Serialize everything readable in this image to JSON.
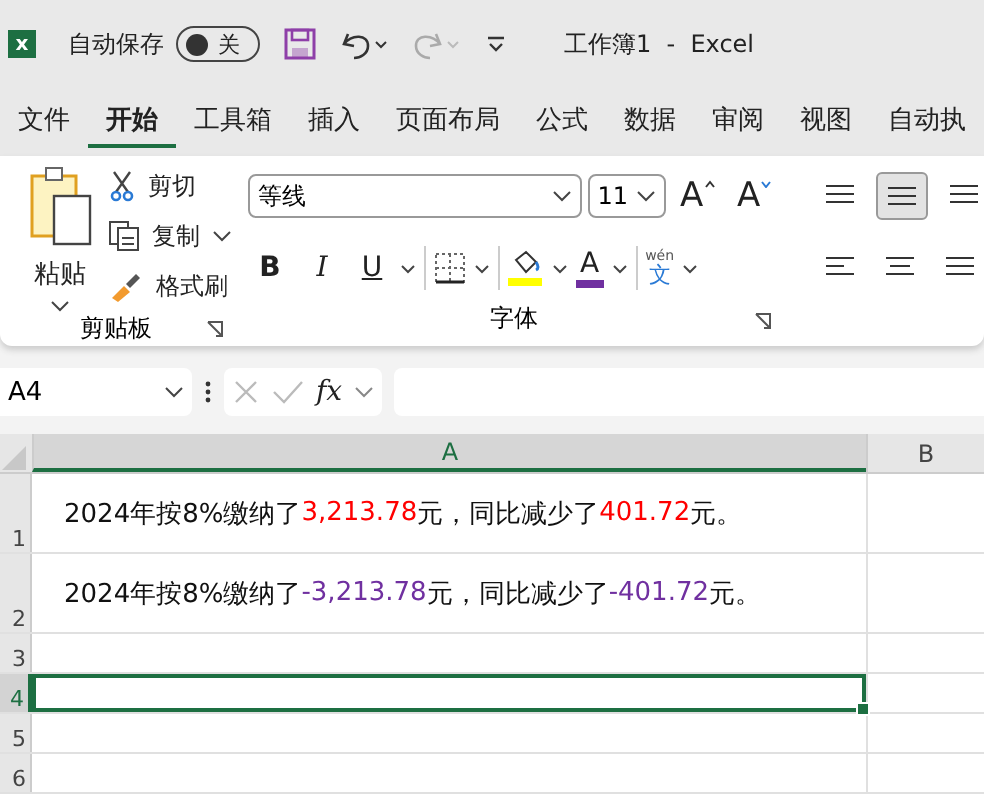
{
  "title_bar": {
    "app_letter": "x",
    "autosave_label": "自动保存",
    "autosave": {
      "on": false,
      "label": "关"
    },
    "title": "工作簿1  -  Excel"
  },
  "tabs": [
    {
      "label": "文件",
      "selected": false
    },
    {
      "label": "开始",
      "selected": true
    },
    {
      "label": "工具箱",
      "selected": false
    },
    {
      "label": "插入",
      "selected": false
    },
    {
      "label": "页面布局",
      "selected": false
    },
    {
      "label": "公式",
      "selected": false
    },
    {
      "label": "数据",
      "selected": false
    },
    {
      "label": "审阅",
      "selected": false
    },
    {
      "label": "视图",
      "selected": false
    },
    {
      "label": "自动执",
      "selected": false
    }
  ],
  "ribbon": {
    "clipboard": {
      "title": "剪贴板",
      "paste": "粘贴",
      "cut": "剪切",
      "copy": "复制",
      "format_painter": "格式刷"
    },
    "font": {
      "title": "字体",
      "font_name": "等线",
      "font_size": "11",
      "grow": "A",
      "shrink": "A",
      "bold": "B",
      "italic": "I",
      "underline": "U",
      "font_color_letter": "A",
      "phonetic_top": "wén",
      "phonetic_char": "文"
    }
  },
  "formula_bar": {
    "name_box": "A4",
    "function_label": "fx"
  },
  "sheet": {
    "columns": [
      {
        "label": "A",
        "selected": true
      },
      {
        "label": "B",
        "selected": false
      }
    ],
    "rows": [
      {
        "label": "1",
        "selected": false,
        "segments": [
          {
            "text": "2024年按8%缴纳了"
          },
          {
            "text": "3,213.78",
            "color": "#ff0000"
          },
          {
            "text": "元，同比减少了"
          },
          {
            "text": "401.72",
            "color": "#ff0000"
          },
          {
            "text": "元。"
          }
        ]
      },
      {
        "label": "2",
        "selected": false,
        "segments": [
          {
            "text": "2024年按8%缴纳了"
          },
          {
            "text": "-3,213.78",
            "color": "#7030a0"
          },
          {
            "text": "元，同比减少了"
          },
          {
            "text": "-401.72",
            "color": "#7030a0"
          },
          {
            "text": "元。"
          }
        ]
      },
      {
        "label": "3",
        "selected": false
      },
      {
        "label": "4",
        "selected": true
      },
      {
        "label": "5",
        "selected": false
      },
      {
        "label": "6",
        "selected": false
      }
    ]
  }
}
